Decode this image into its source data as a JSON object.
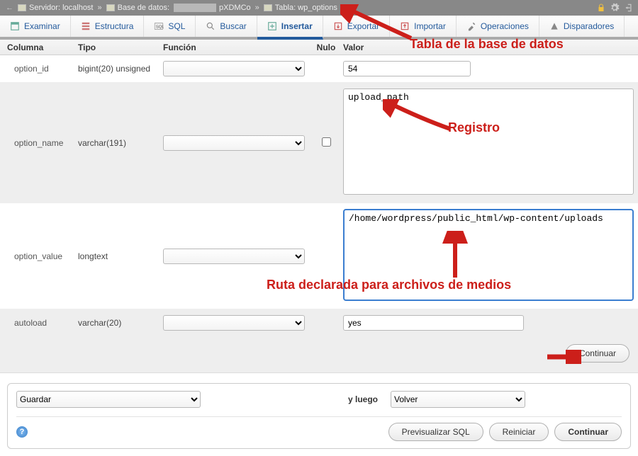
{
  "topbar": {
    "server_label": "Servidor: localhost",
    "db_label": "Base de datos:",
    "db_suffix": "pXDMCo",
    "table_label": "Tabla: wp_options"
  },
  "tabs": [
    {
      "label": "Examinar"
    },
    {
      "label": "Estructura"
    },
    {
      "label": "SQL"
    },
    {
      "label": "Buscar"
    },
    {
      "label": "Insertar"
    },
    {
      "label": "Exportar"
    },
    {
      "label": "Importar"
    },
    {
      "label": "Operaciones"
    },
    {
      "label": "Disparadores"
    }
  ],
  "headers": {
    "column": "Columna",
    "type": "Tipo",
    "function": "Función",
    "null": "Nulo",
    "value": "Valor"
  },
  "rows": {
    "option_id": {
      "name": "option_id",
      "type": "bigint(20) unsigned",
      "value": "54"
    },
    "option_name": {
      "name": "option_name",
      "type": "varchar(191)",
      "value": "upload_path"
    },
    "option_value": {
      "name": "option_value",
      "type": "longtext",
      "value": "/home/wordpress/public_html/wp-content/uploads"
    },
    "autoload": {
      "name": "autoload",
      "type": "varchar(20)",
      "value": "yes"
    }
  },
  "buttons": {
    "continue": "Continuar",
    "preview_sql": "Previsualizar SQL",
    "reset": "Reiniciar"
  },
  "bottom": {
    "save_option": "Guardar",
    "then_label": "y luego",
    "back_option": "Volver"
  },
  "annotations": {
    "table": "Tabla de la base de datos",
    "record": "Registro",
    "path": "Ruta declarada para archivos de medios"
  }
}
